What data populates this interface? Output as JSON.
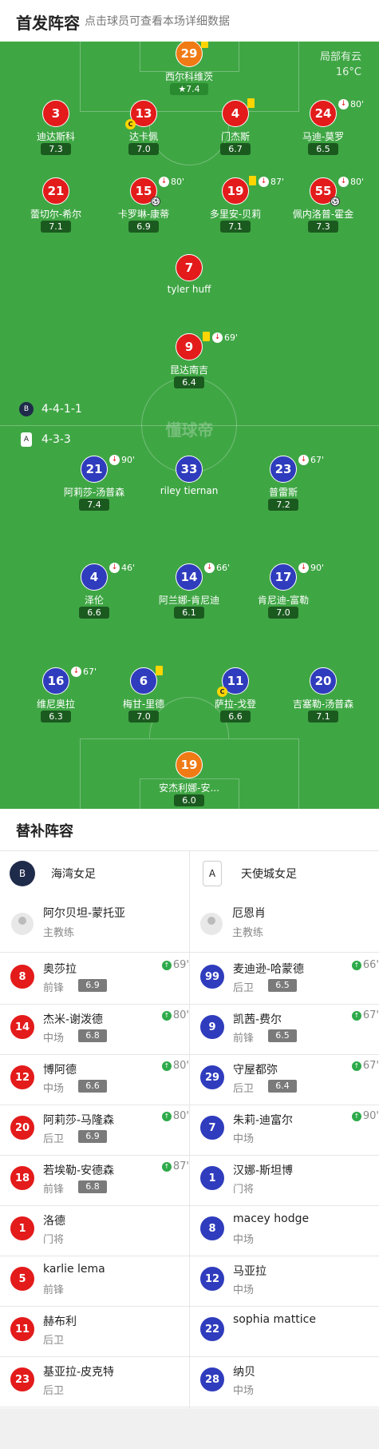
{
  "header": {
    "title": "首发阵容",
    "subtitle": "点击球员可查看本场详细数据"
  },
  "weather": {
    "line1": "局部有云",
    "line2": "16°C"
  },
  "watermark": "懂球帝",
  "formations": {
    "home": "4-4-1-1",
    "away": "4-3-3",
    "home_logo": "B",
    "away_logo": "A"
  },
  "players": [
    {
      "num": "29",
      "name": "西尔科维茨",
      "rating": "7.4",
      "color": "orange",
      "star": true,
      "yellow": true
    },
    {
      "num": "3",
      "name": "迪达斯科",
      "rating": "7.3",
      "color": "red"
    },
    {
      "num": "13",
      "name": "达卡佩",
      "rating": "7.0",
      "color": "red",
      "captain": true
    },
    {
      "num": "4",
      "name": "门杰斯",
      "rating": "6.7",
      "color": "red",
      "yellow": true
    },
    {
      "num": "24",
      "name": "马迪-莫罗",
      "rating": "6.5",
      "color": "red",
      "sub": "80'"
    },
    {
      "num": "21",
      "name": "蕾切尔-希尔",
      "rating": "7.1",
      "color": "red"
    },
    {
      "num": "15",
      "name": "卡罗琳-康蒂",
      "rating": "6.9",
      "color": "red",
      "sub": "80'",
      "ball": true
    },
    {
      "num": "19",
      "name": "多里安-贝莉",
      "rating": "7.1",
      "color": "red",
      "sub": "87'",
      "yellow": true
    },
    {
      "num": "55",
      "name": "佩内洛普-霍金",
      "rating": "7.3",
      "color": "red",
      "sub": "80'",
      "ball": true
    },
    {
      "num": "7",
      "name": "tyler huff",
      "rating": "",
      "color": "red"
    },
    {
      "num": "9",
      "name": "昆达南吉",
      "rating": "6.4",
      "color": "red",
      "sub": "69'",
      "yellow": true
    },
    {
      "num": "21",
      "name": "阿莉莎-汤普森",
      "rating": "7.4",
      "color": "blue",
      "sub": "90'"
    },
    {
      "num": "33",
      "name": "riley tiernan",
      "rating": "",
      "color": "blue"
    },
    {
      "num": "23",
      "name": "普雷斯",
      "rating": "7.2",
      "color": "blue",
      "sub": "67'"
    },
    {
      "num": "4",
      "name": "泽伦",
      "rating": "6.6",
      "color": "blue",
      "sub": "46'"
    },
    {
      "num": "14",
      "name": "阿兰娜-肯尼迪",
      "rating": "6.1",
      "color": "blue",
      "sub": "66'"
    },
    {
      "num": "17",
      "name": "肯尼迪-富勒",
      "rating": "7.0",
      "color": "blue",
      "sub": "90'"
    },
    {
      "num": "16",
      "name": "维尼奥拉",
      "rating": "6.3",
      "color": "blue",
      "sub": "67'"
    },
    {
      "num": "6",
      "name": "梅甘-里德",
      "rating": "7.0",
      "color": "blue",
      "yellow": true
    },
    {
      "num": "11",
      "name": "萨拉-戈登",
      "rating": "6.6",
      "color": "blue",
      "captain": true
    },
    {
      "num": "20",
      "name": "吉塞勒-汤普森",
      "rating": "7.1",
      "color": "blue"
    },
    {
      "num": "19",
      "name": "安杰利娜-安...",
      "rating": "6.0",
      "color": "orange"
    }
  ],
  "bench": {
    "title": "替补阵容",
    "home": {
      "team": "海湾女足",
      "logo": "B",
      "coach": "阿尔贝坦-蒙托亚",
      "coach_role": "主教练"
    },
    "away": {
      "team": "天使城女足",
      "logo": "A",
      "coach": "厄恩肖",
      "coach_role": "主教练"
    },
    "home_players": [
      {
        "num": "8",
        "name": "奥莎拉",
        "pos": "前锋",
        "rating": "6.9",
        "in": "69'"
      },
      {
        "num": "14",
        "name": "杰米-谢泼德",
        "pos": "中场",
        "rating": "6.8",
        "in": "80'"
      },
      {
        "num": "12",
        "name": "博阿德",
        "pos": "中场",
        "rating": "6.6",
        "in": "80'"
      },
      {
        "num": "20",
        "name": "阿莉莎-马隆森",
        "pos": "后卫",
        "rating": "6.9",
        "in": "80'"
      },
      {
        "num": "18",
        "name": "若埃勒-安德森",
        "pos": "前锋",
        "rating": "6.8",
        "in": "87'"
      },
      {
        "num": "1",
        "name": "洛德",
        "pos": "门将"
      },
      {
        "num": "5",
        "name": "karlie lema",
        "pos": "前锋"
      },
      {
        "num": "11",
        "name": "赫布利",
        "pos": "后卫"
      },
      {
        "num": "23",
        "name": "基亚拉-皮克特",
        "pos": "后卫"
      }
    ],
    "away_players": [
      {
        "num": "99",
        "name": "麦迪逊-哈蒙德",
        "pos": "后卫",
        "rating": "6.5",
        "in": "66'"
      },
      {
        "num": "9",
        "name": "凯茜-费尔",
        "pos": "前锋",
        "rating": "6.5",
        "in": "67'"
      },
      {
        "num": "29",
        "name": "守屋都弥",
        "pos": "后卫",
        "rating": "6.4",
        "in": "67'"
      },
      {
        "num": "7",
        "name": "朱莉-迪富尔",
        "pos": "中场",
        "in": "90'"
      },
      {
        "num": "1",
        "name": "汉娜-斯坦博",
        "pos": "门将"
      },
      {
        "num": "8",
        "name": "macey hodge",
        "pos": "中场"
      },
      {
        "num": "12",
        "name": "马亚拉",
        "pos": "中场"
      },
      {
        "num": "22",
        "name": "sophia mattice",
        "pos": ""
      },
      {
        "num": "28",
        "name": "纳贝",
        "pos": "中场"
      }
    ]
  },
  "colors": {
    "pitch": "#3fa644",
    "red": "#e31b1b",
    "blue": "#2f3cbd",
    "orange": "#f07a14"
  }
}
